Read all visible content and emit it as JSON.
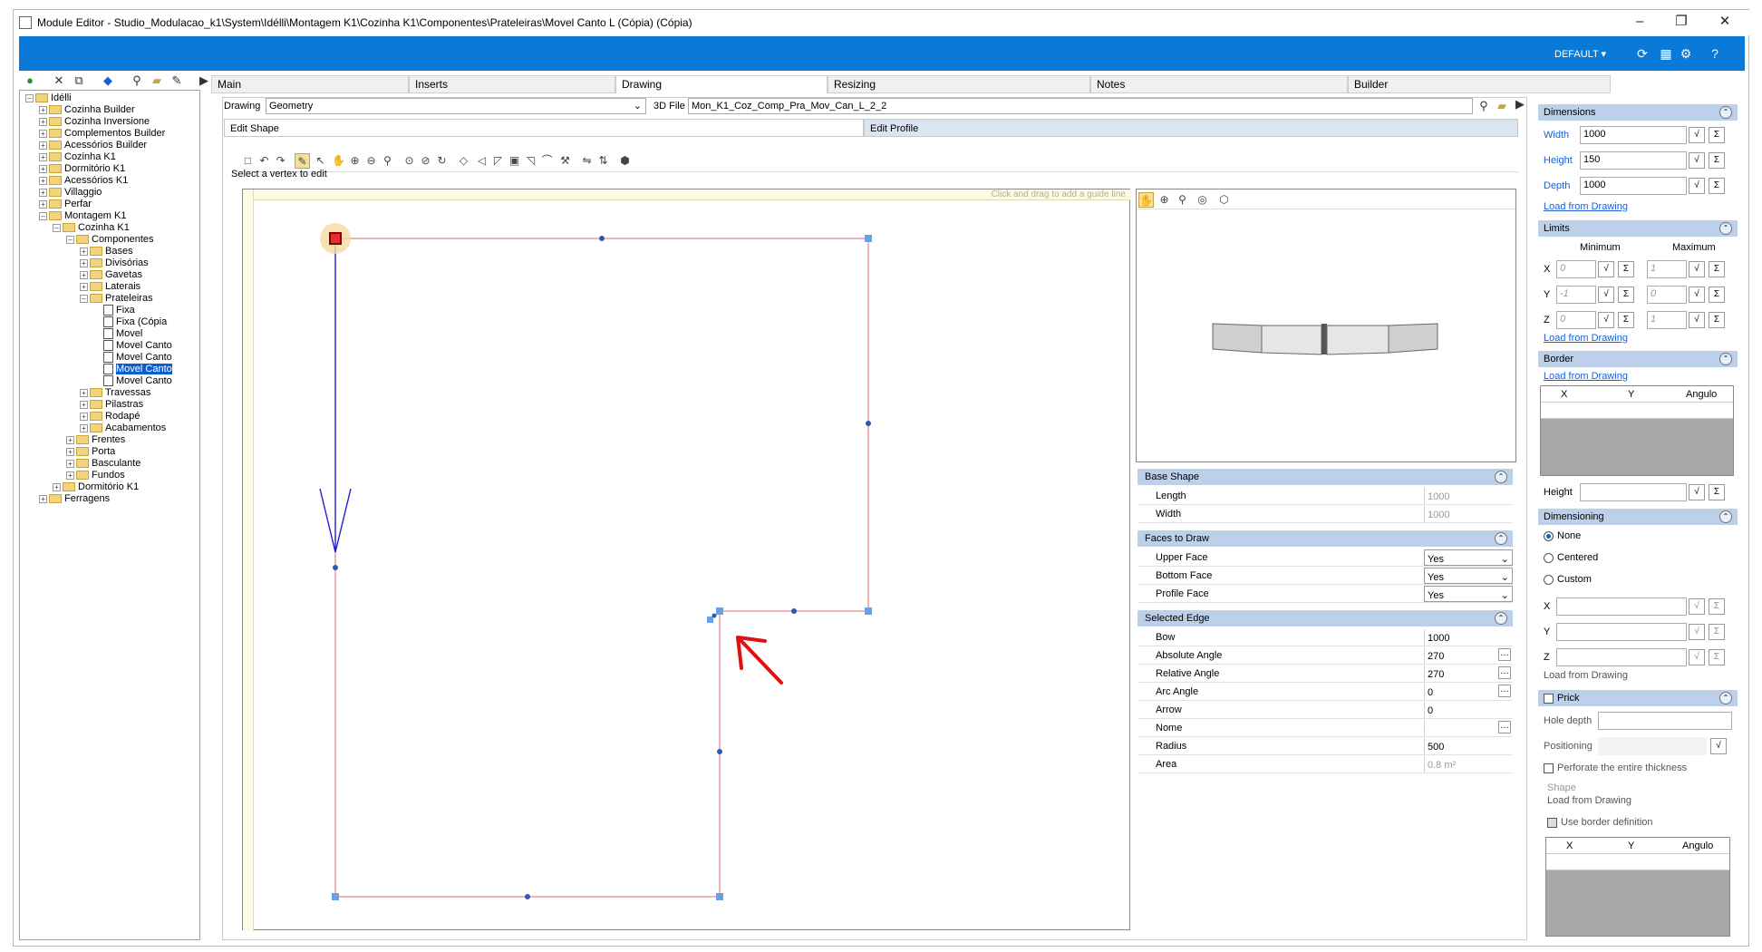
{
  "window": {
    "title": "Module Editor - Studio_Modulacao_k1\\System\\Idélli\\Montagem K1\\Cozinha K1\\Componentes\\Prateleiras\\Movel Canto L (Cópia) (Cópia)",
    "minimize": "–",
    "maximize": "❐",
    "close": "✕"
  },
  "topbar": {
    "profile": "DEFAULT"
  },
  "tree": {
    "nodes": [
      {
        "label": "Idélli",
        "level": 0,
        "pm": "-",
        "type": "folder"
      },
      {
        "label": "Cozinha Builder",
        "level": 1,
        "pm": "+",
        "type": "folder"
      },
      {
        "label": "Cozinha Inversione",
        "level": 1,
        "pm": "+",
        "type": "folder"
      },
      {
        "label": "Complementos Builder",
        "level": 1,
        "pm": "+",
        "type": "folder"
      },
      {
        "label": "Acessórios Builder",
        "level": 1,
        "pm": "+",
        "type": "folder"
      },
      {
        "label": "Cozinha K1",
        "level": 1,
        "pm": "+",
        "type": "folder"
      },
      {
        "label": "Dormitório K1",
        "level": 1,
        "pm": "+",
        "type": "folder"
      },
      {
        "label": "Acessórios K1",
        "level": 1,
        "pm": "+",
        "type": "folder"
      },
      {
        "label": "Villaggio",
        "level": 1,
        "pm": "+",
        "type": "folder"
      },
      {
        "label": "Perfar",
        "level": 1,
        "pm": "+",
        "type": "folder"
      },
      {
        "label": "Montagem K1",
        "level": 1,
        "pm": "-",
        "type": "folder"
      },
      {
        "label": "Cozinha K1",
        "level": 2,
        "pm": "-",
        "type": "folder"
      },
      {
        "label": "Componentes",
        "level": 3,
        "pm": "-",
        "type": "folder"
      },
      {
        "label": "Bases",
        "level": 4,
        "pm": "+",
        "type": "folder"
      },
      {
        "label": "Divisórias",
        "level": 4,
        "pm": "+",
        "type": "folder"
      },
      {
        "label": "Gavetas",
        "level": 4,
        "pm": "+",
        "type": "folder"
      },
      {
        "label": "Laterais",
        "level": 4,
        "pm": "+",
        "type": "folder"
      },
      {
        "label": "Prateleiras",
        "level": 4,
        "pm": "-",
        "type": "folder"
      },
      {
        "label": "Fixa",
        "level": 5,
        "pm": "",
        "type": "doc"
      },
      {
        "label": "Fixa (Cópia",
        "level": 5,
        "pm": "",
        "type": "doc"
      },
      {
        "label": "Movel",
        "level": 5,
        "pm": "",
        "type": "doc"
      },
      {
        "label": "Movel Canto",
        "level": 5,
        "pm": "",
        "type": "doc"
      },
      {
        "label": "Movel Canto",
        "level": 5,
        "pm": "",
        "type": "doc"
      },
      {
        "label": "Movel Canto",
        "level": 5,
        "pm": "",
        "type": "doc",
        "selected": true
      },
      {
        "label": "Movel Canto",
        "level": 5,
        "pm": "",
        "type": "doc"
      },
      {
        "label": "Travessas",
        "level": 4,
        "pm": "+",
        "type": "folder"
      },
      {
        "label": "Pilastras",
        "level": 4,
        "pm": "+",
        "type": "folder"
      },
      {
        "label": "Rodapé",
        "level": 4,
        "pm": "+",
        "type": "folder"
      },
      {
        "label": "Acabamentos",
        "level": 4,
        "pm": "+",
        "type": "folder"
      },
      {
        "label": "Frentes",
        "level": 3,
        "pm": "+",
        "type": "folder"
      },
      {
        "label": "Porta",
        "level": 3,
        "pm": "+",
        "type": "folder"
      },
      {
        "label": "Basculante",
        "level": 3,
        "pm": "+",
        "type": "folder"
      },
      {
        "label": "Fundos",
        "level": 3,
        "pm": "+",
        "type": "folder"
      },
      {
        "label": "Dormitório K1",
        "level": 2,
        "pm": "+",
        "type": "folder"
      },
      {
        "label": "Ferragens",
        "level": 1,
        "pm": "+",
        "type": "folder"
      }
    ]
  },
  "tabs": [
    "Main",
    "Inserts",
    "Drawing",
    "Resizing",
    "Notes",
    "Builder"
  ],
  "drawing": {
    "drawing_label": "Drawing",
    "drawing_value": "Geometry",
    "file_label": "3D File",
    "file_value": "Mon_K1_Coz_Comp_Pra_Mov_Can_L_2_2",
    "subtabs": [
      "Edit Shape",
      "Edit Profile"
    ],
    "hint": "Select a vertex to edit",
    "guide_hint": "Click and drag to add a guide line"
  },
  "base_shape": {
    "title": "Base Shape",
    "rows": [
      {
        "k": "Length",
        "v": "1000"
      },
      {
        "k": "Width",
        "v": "1000"
      }
    ]
  },
  "faces": {
    "title": "Faces to Draw",
    "rows": [
      {
        "k": "Upper Face",
        "v": "Yes"
      },
      {
        "k": "Bottom Face",
        "v": "Yes"
      },
      {
        "k": "Profile Face",
        "v": "Yes"
      }
    ]
  },
  "selected_edge": {
    "title": "Selected Edge",
    "rows": [
      {
        "k": "Bow",
        "v": "1000"
      },
      {
        "k": "Absolute Angle",
        "v": "270"
      },
      {
        "k": "Relative Angle",
        "v": "270"
      },
      {
        "k": "Arc Angle",
        "v": "0"
      },
      {
        "k": "Arrow",
        "v": "0"
      },
      {
        "k": "Nome",
        "v": ""
      },
      {
        "k": "Radius",
        "v": "500"
      },
      {
        "k": "Area",
        "v": "0.8 m²"
      }
    ]
  },
  "dimensions": {
    "title": "Dimensions",
    "width_label": "Width",
    "width": "1000",
    "height_label": "Height",
    "height": "150",
    "depth_label": "Depth",
    "depth": "1000",
    "load": "Load from Drawing"
  },
  "limits": {
    "title": "Limits",
    "min": "Minimum",
    "max": "Maximum",
    "x": "X",
    "y": "Y",
    "z": "Z",
    "xmin": "0",
    "xmax": "1",
    "ymin": "-1",
    "ymax": "0",
    "zmin": "0",
    "zmax": "1",
    "load": "Load from Drawing"
  },
  "border": {
    "title": "Border",
    "load": "Load from Drawing",
    "cols": [
      "X",
      "Y",
      "Angulo"
    ],
    "height_label": "Height"
  },
  "dimensioning": {
    "title": "Dimensioning",
    "opt_none": "None",
    "opt_centered": "Centered",
    "opt_custom": "Custom",
    "x": "X",
    "y": "Y",
    "z": "Z",
    "load": "Load from Drawing"
  },
  "prick": {
    "title": "Prick",
    "hole_depth": "Hole depth",
    "positioning": "Positioning",
    "perforate": "Perforate the entire thickness",
    "shape": "Shape",
    "load": "Load from Drawing",
    "use_border": "Use border definition",
    "cols": [
      "X",
      "Y",
      "Angulo"
    ]
  },
  "icons": {
    "sigma": "Σ",
    "sqrt": "√",
    "collapse": "⌃"
  },
  "colors": {
    "accent": "#0a7ad8",
    "section": "#bdd0ea",
    "edge": "#e26a6a",
    "selected_edge": "#2020d0",
    "annotation": "#e01010"
  }
}
